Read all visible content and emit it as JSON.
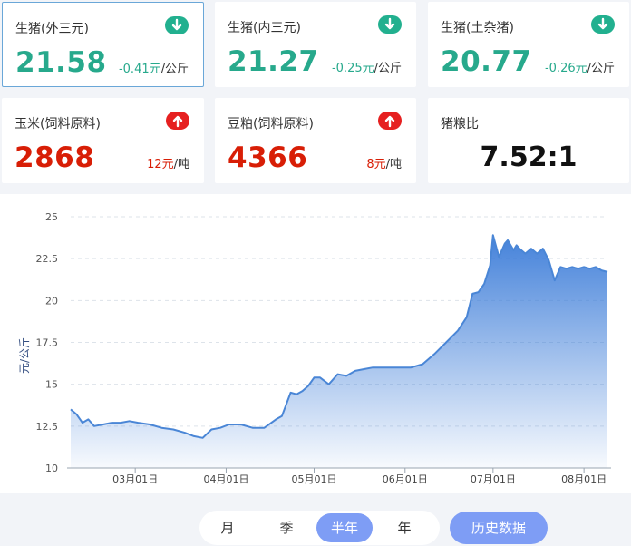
{
  "cards": [
    {
      "title": "生猪(外三元)",
      "value": "21.58",
      "change": "-0.41元",
      "unit": "/公斤",
      "trend": "down",
      "icon": "arrow-down-icon"
    },
    {
      "title": "生猪(内三元)",
      "value": "21.27",
      "change": "-0.25元",
      "unit": "/公斤",
      "trend": "down",
      "icon": "arrow-down-icon"
    },
    {
      "title": "生猪(土杂猪)",
      "value": "20.77",
      "change": "-0.26元",
      "unit": "/公斤",
      "trend": "down",
      "icon": "arrow-down-icon"
    },
    {
      "title": "玉米(饲料原料)",
      "value": "2868",
      "change": "12元",
      "unit": "/吨",
      "trend": "up",
      "icon": "arrow-up-icon"
    },
    {
      "title": "豆粕(饲料原料)",
      "value": "4366",
      "change": "8元",
      "unit": "/吨",
      "trend": "up",
      "icon": "arrow-up-icon"
    },
    {
      "title": "猪粮比",
      "value": "7.52:1"
    }
  ],
  "colors": {
    "up": "#d81e06",
    "down": "#27a98c",
    "line": "#4a86d6",
    "accent": "#7e9df5"
  },
  "chart_data": {
    "type": "area",
    "ylabel": "元/公斤",
    "ylim": [
      10,
      25
    ],
    "yticks": [
      "10",
      "12.5",
      "15",
      "17.5",
      "20",
      "22.5",
      "25"
    ],
    "xticks": [
      "03月01日",
      "04月01日",
      "05月01日",
      "06月01日",
      "07月01日",
      "08月01日"
    ],
    "xlim": [
      "2021-02-07",
      "2021-08-09"
    ],
    "grid": true,
    "series": [
      {
        "x": [
          "2021-02-07",
          "2021-02-09",
          "2021-02-11",
          "2021-02-13",
          "2021-02-15",
          "2021-02-18",
          "2021-02-21",
          "2021-02-24",
          "2021-02-27",
          "2021-03-02",
          "2021-03-06",
          "2021-03-10",
          "2021-03-14",
          "2021-03-18",
          "2021-03-21",
          "2021-03-24",
          "2021-03-27",
          "2021-03-30",
          "2021-04-02",
          "2021-04-06",
          "2021-04-10",
          "2021-04-14",
          "2021-04-18",
          "2021-04-20",
          "2021-04-23",
          "2021-04-25",
          "2021-04-27",
          "2021-04-29",
          "2021-05-01",
          "2021-05-03",
          "2021-05-06",
          "2021-05-09",
          "2021-05-12",
          "2021-05-15",
          "2021-05-18",
          "2021-05-21",
          "2021-05-24",
          "2021-05-27",
          "2021-05-30",
          "2021-06-03",
          "2021-06-07",
          "2021-06-11",
          "2021-06-15",
          "2021-06-19",
          "2021-06-22",
          "2021-06-24",
          "2021-06-26",
          "2021-06-28",
          "2021-06-30",
          "2021-07-01",
          "2021-07-03",
          "2021-07-05",
          "2021-07-06",
          "2021-07-08",
          "2021-07-09",
          "2021-07-10",
          "2021-07-12",
          "2021-07-14",
          "2021-07-16",
          "2021-07-18",
          "2021-07-20",
          "2021-07-22",
          "2021-07-24",
          "2021-07-26",
          "2021-07-28",
          "2021-07-30",
          "2021-08-01",
          "2021-08-03",
          "2021-08-05",
          "2021-08-07",
          "2021-08-09"
        ],
        "y": [
          13.5,
          13.2,
          12.7,
          12.9,
          12.5,
          12.6,
          12.7,
          12.7,
          12.8,
          12.7,
          12.6,
          12.4,
          12.3,
          12.1,
          11.9,
          11.8,
          12.3,
          12.4,
          12.6,
          12.6,
          12.4,
          12.4,
          12.9,
          13.1,
          14.5,
          14.4,
          14.6,
          14.9,
          15.4,
          15.4,
          15.0,
          15.6,
          15.5,
          15.8,
          15.9,
          16.0,
          16.0,
          16.0,
          16.0,
          16.0,
          16.2,
          16.8,
          17.5,
          18.2,
          19.0,
          20.4,
          20.5,
          21.0,
          22.1,
          23.9,
          22.6,
          23.4,
          23.6,
          23.0,
          23.3,
          23.1,
          22.8,
          23.1,
          22.8,
          23.1,
          22.4,
          21.2,
          22.0,
          21.9,
          22.0,
          21.9,
          22.0,
          21.9,
          22.0,
          21.8,
          21.7
        ]
      }
    ]
  },
  "controls": {
    "segments": [
      "月",
      "季",
      "半年",
      "年"
    ],
    "active": "半年",
    "history_label": "历史数据"
  }
}
